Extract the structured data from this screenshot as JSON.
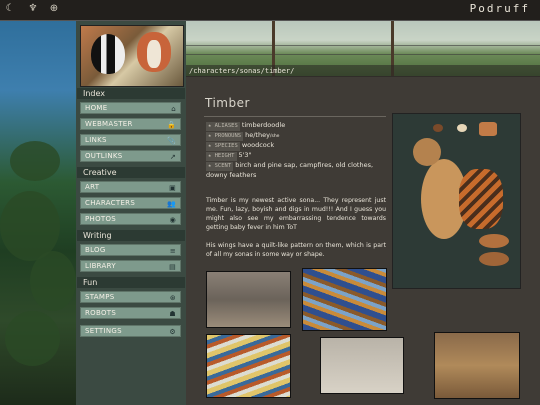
{
  "brand": "Podruff",
  "topbar_icons": [
    "moon-icon",
    "tooth-icon",
    "target-icon"
  ],
  "path": "/characters/sonas/timber/",
  "nav": {
    "sections": [
      {
        "title": "Index",
        "items": [
          {
            "label": "HOME",
            "icon": "home-icon",
            "glyph": "⌂"
          },
          {
            "label": "WEBMASTER",
            "icon": "lock-icon",
            "glyph": "🔒"
          },
          {
            "label": "LINKS",
            "icon": "paperclip-icon",
            "glyph": "📎"
          },
          {
            "label": "OUTLINKS",
            "icon": "external-link-icon",
            "glyph": "↗"
          }
        ]
      },
      {
        "title": "Creative",
        "items": [
          {
            "label": "ART",
            "icon": "image-icon",
            "glyph": "▣"
          },
          {
            "label": "CHARACTERS",
            "icon": "users-icon",
            "glyph": "👥"
          },
          {
            "label": "PHOTOS",
            "icon": "camera-icon",
            "glyph": "◉"
          }
        ]
      },
      {
        "title": "Writing",
        "items": [
          {
            "label": "BLOG",
            "icon": "text-icon",
            "glyph": "≡"
          },
          {
            "label": "LIBRARY",
            "icon": "book-icon",
            "glyph": "▤"
          }
        ]
      },
      {
        "title": "Fun",
        "items": [
          {
            "label": "STAMPS",
            "icon": "badge-icon",
            "glyph": "⊛"
          },
          {
            "label": "ROBOTS",
            "icon": "robot-icon",
            "glyph": "☗"
          }
        ]
      }
    ],
    "settings": {
      "label": "SETTINGS",
      "icon": "gear-icon",
      "glyph": "⚙"
    }
  },
  "content": {
    "title": "Timber",
    "facts": [
      {
        "tag": "ALIASES",
        "value": "timberdoodle"
      },
      {
        "tag": "PRONOUNS",
        "value": "he/they",
        "small": "/she"
      },
      {
        "tag": "SPECIES",
        "value": "woodcock"
      },
      {
        "tag": "HEIGHT",
        "value": "5'3\""
      },
      {
        "tag": "SCENT",
        "value": "birch and pine sap, campfires, old clothes, downy feathers"
      }
    ],
    "para1": "Timber is my newest active sona... They represent just me. Fun, lazy, boyish and digs in mud!!! And I guess you might also see my embarrassing tendence towards getting baby fever in him ToT",
    "para2": "His wings have a quilt-like pattern on them, which is part of all my sonas in some way or shape."
  }
}
